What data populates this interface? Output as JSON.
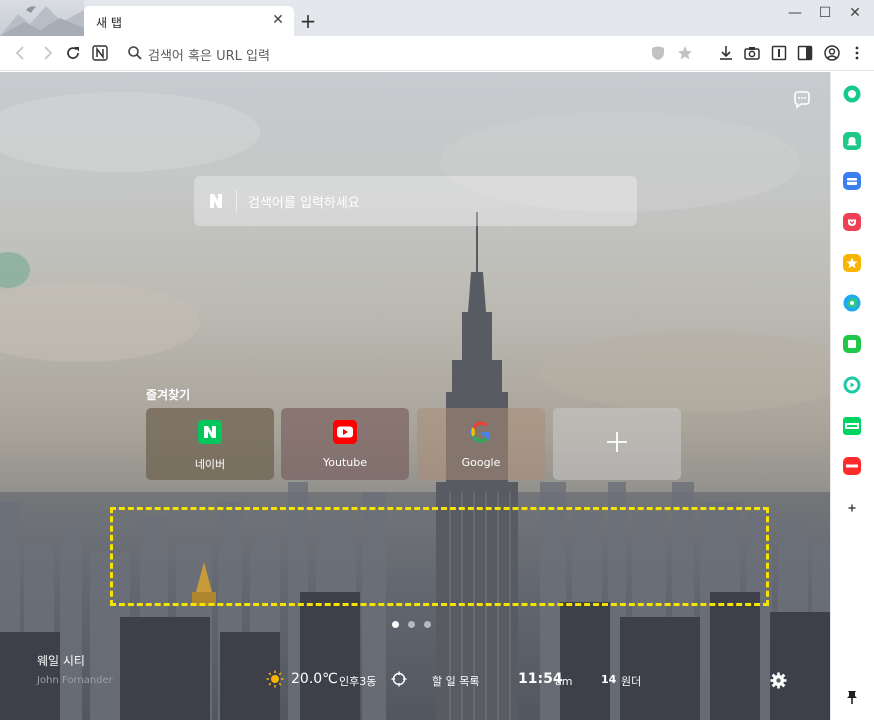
{
  "tab": {
    "title": "새 탭",
    "close": "✕",
    "new_tab": "+"
  },
  "window": {
    "minimize": "—",
    "maximize": "☐",
    "close": "✕"
  },
  "toolbar": {
    "address_placeholder": "검색어 혹은 URL 입력"
  },
  "search": {
    "placeholder": "검색어를 입력하세요"
  },
  "favorites": {
    "title": "즐겨찾기",
    "items": [
      {
        "label": "네이버",
        "glyph": "N",
        "color": "#03c75a"
      },
      {
        "label": "Youtube",
        "glyph": "▶",
        "color": "#ff0000"
      },
      {
        "label": "Google",
        "glyph": "G",
        "color": "#4285f4"
      },
      {
        "label": "",
        "glyph": "+",
        "color": "#ffffff"
      }
    ]
  },
  "wallpaper": {
    "city": "웨일 시티",
    "author": "John Fornander"
  },
  "status": {
    "temperature": "20.0℃",
    "location": "인후3동",
    "todo": "할 일 목록",
    "time": "11:54",
    "ampm": "am",
    "won_count": "14",
    "won_label": "원더"
  },
  "colors": {
    "naver_green": "#03c75a",
    "youtube_red": "#ff0000",
    "highlight_yellow": "#f5e400"
  }
}
